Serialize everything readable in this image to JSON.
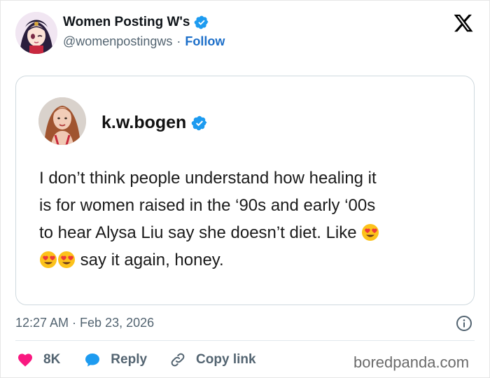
{
  "tweet": {
    "author_name": "Women Posting W's",
    "author_handle": "@womenpostingws",
    "separator": "·",
    "follow_label": "Follow",
    "timestamp": "12:27 AM · Feb 23, 2026"
  },
  "quote": {
    "author_name": "k.w.bogen",
    "lines": [
      "I don’t think people understand how healing it",
      "is for women raised in the ‘90s and early ‘00s",
      "to hear Alysa Liu say she doesn’t diet. Like",
      "say it again, honey."
    ],
    "emoji": "smiling-face-with-heart-eyes"
  },
  "actions": {
    "like_count": "8K",
    "reply_label": "Reply",
    "copy_link_label": "Copy link"
  },
  "watermark": "boredpanda.com",
  "colors": {
    "accent_blue": "#1d9bf0",
    "follow_blue": "#1d6fc9",
    "like_red": "#f91880",
    "muted_text": "#536471",
    "card_border": "#cfd9de"
  },
  "icons": [
    "x-logo-icon",
    "verified-badge-icon",
    "info-icon",
    "heart-icon",
    "reply-bubble-icon",
    "link-icon"
  ]
}
